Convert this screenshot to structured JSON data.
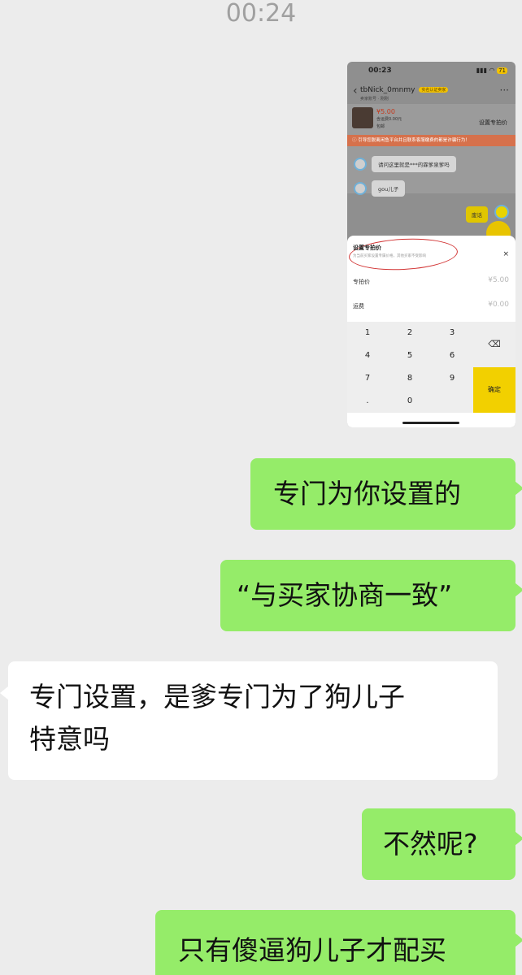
{
  "status_bar": {
    "time": "00:24"
  },
  "embedded_screenshot": {
    "time": "00:23",
    "battery": "71",
    "username": "tbNick_0mnmy",
    "user_badge": "实名认证卖家",
    "user_subtitle": "卖家账号 · 刚刚",
    "product_price": "¥5.00",
    "product_shipping": "含运费0.00元",
    "product_note": "包邮",
    "set_price_link": "设置专拍价",
    "warning_banner": "引导您脱离闲鱼平台并且联系客服缴费的都是诈骗行为！",
    "messages": [
      {
        "text": "请问这里就是***的霖爹泉爹吗"
      },
      {
        "text": "gou儿子"
      }
    ],
    "outgoing_message": "废话",
    "sheet": {
      "title": "设置专拍价",
      "subtitle": "为当前买家设置专属价格，其他买家不受影响",
      "close": "×",
      "price_label": "专拍价",
      "price_value": "¥5.00",
      "shipping_label": "运费",
      "shipping_value": "¥0.00"
    },
    "keypad": {
      "keys": [
        "1",
        "2",
        "3",
        "4",
        "5",
        "6",
        "7",
        "8",
        "9",
        ".",
        "0"
      ],
      "delete_icon": "⌫",
      "confirm": "确定"
    }
  },
  "chat": {
    "messages": [
      {
        "direction": "out",
        "text": "专门为你设置的"
      },
      {
        "direction": "out",
        "text": "“与买家协商一致”"
      },
      {
        "direction": "in",
        "line1": "专门设置，是爹专门为了狗儿子",
        "line2": "特意吗"
      },
      {
        "direction": "out",
        "text": "不然呢?"
      },
      {
        "direction": "out",
        "text": "只有傻逼狗儿子才配买"
      }
    ]
  }
}
